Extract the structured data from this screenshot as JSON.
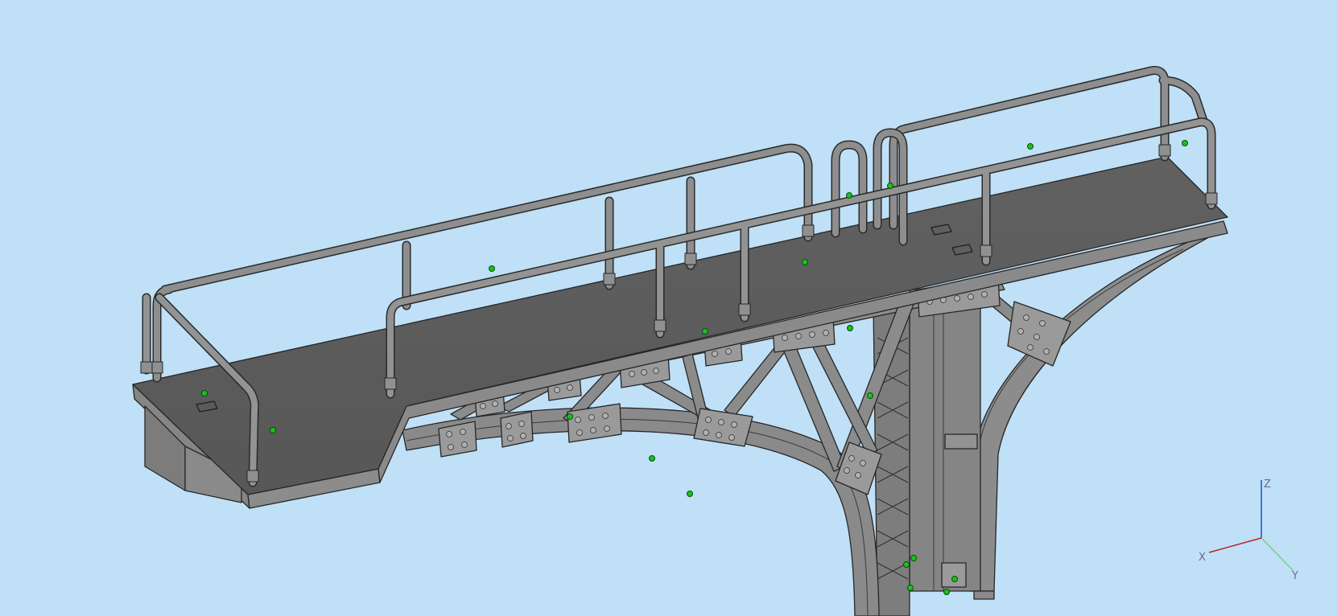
{
  "viewport": {
    "background_color": "#bfe0f7",
    "model_color": "#7a7a7a",
    "model_edge_color": "#2c2c2c",
    "vertex_marker_color": "#19c219"
  },
  "axis_triad": {
    "x_label": "X",
    "y_label": "Y",
    "z_label": "Z",
    "x_color": "#c0202a",
    "y_color": "#6fd18a",
    "z_color": "#2050c8"
  }
}
